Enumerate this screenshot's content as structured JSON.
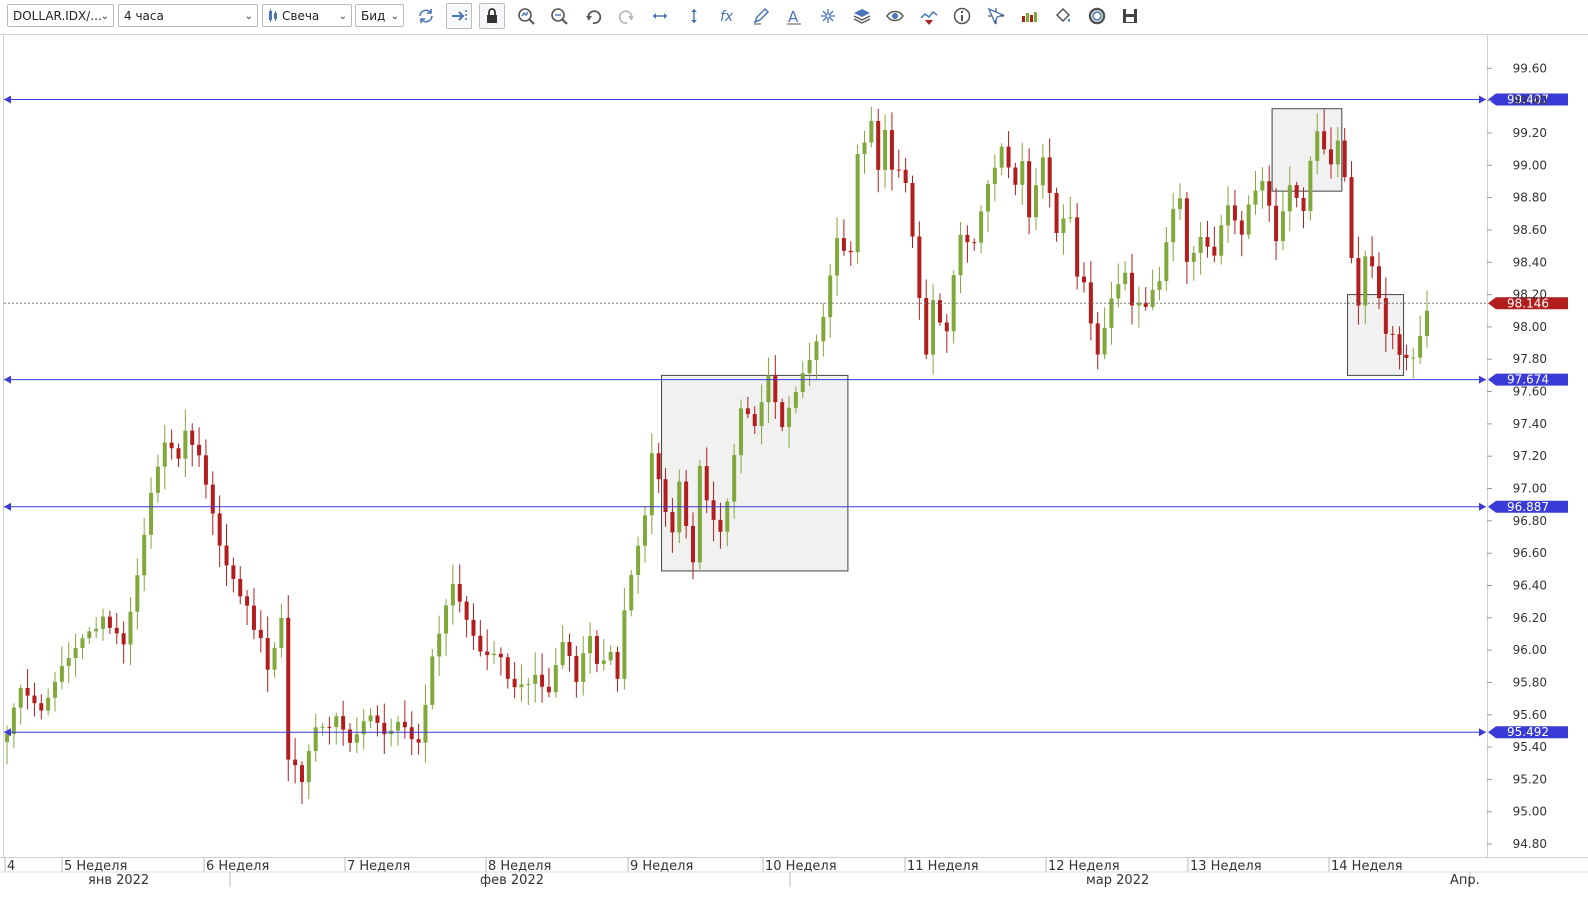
{
  "toolbar": {
    "symbol": "DOLLAR.IDX/...",
    "period": "4 часа",
    "chart_type": "Свеча",
    "price_side": "Бид",
    "tools": [
      {
        "name": "refresh-icon"
      },
      {
        "name": "autoshift-icon",
        "boxed": true
      },
      {
        "name": "lock-icon",
        "boxed": true
      },
      {
        "name": "zoom-in-icon"
      },
      {
        "name": "zoom-out-icon"
      },
      {
        "name": "undo-icon"
      },
      {
        "name": "redo-icon"
      },
      {
        "name": "horizontal-scale-icon"
      },
      {
        "name": "vertical-scale-icon"
      },
      {
        "name": "indicators-fx-icon"
      },
      {
        "name": "pencil-icon"
      },
      {
        "name": "text-tool-icon"
      },
      {
        "name": "crosshair-star-icon"
      },
      {
        "name": "layers-icon"
      },
      {
        "name": "eye-icon"
      },
      {
        "name": "signals-icon"
      },
      {
        "name": "info-icon"
      },
      {
        "name": "cursor-icon"
      },
      {
        "name": "volume-bars-icon"
      },
      {
        "name": "paint-bucket-icon"
      },
      {
        "name": "theme-icon"
      },
      {
        "name": "save-icon"
      }
    ]
  },
  "colors": {
    "up": "#80a83a",
    "down": "#b21d1d",
    "hline": "#3a3ad6",
    "current": "#b21d1d",
    "box_fill": "#efefef",
    "box_stroke": "#444444"
  },
  "chart_data": {
    "type": "candlestick",
    "title": "",
    "ylim": [
      94.72,
      99.8
    ],
    "y_ticks": [
      "99.60",
      "99.40",
      "99.20",
      "99.00",
      "98.80",
      "98.60",
      "98.40",
      "98.20",
      "98.00",
      "97.80",
      "97.60",
      "97.40",
      "97.20",
      "97.00",
      "96.80",
      "96.60",
      "96.40",
      "96.20",
      "96.00",
      "95.80",
      "95.60",
      "95.40",
      "95.20",
      "95.00",
      "94.80"
    ],
    "x_week_labels": [
      "4",
      "5 Неделя",
      "6 Неделя",
      "7 Неделя",
      "8 Неделя",
      "9 Неделя",
      "10 Неделя",
      "11 Неделя",
      "12 Неделя",
      "13 Неделя",
      "14 Неделя"
    ],
    "x_month_labels": [
      "янв 2022",
      "фев 2022",
      "мар 2022",
      "Апр."
    ],
    "horizontal_lines": [
      99.407,
      97.674,
      96.887,
      95.492
    ],
    "horizontal_line_labels": [
      "99.407",
      "97.674",
      "96.887",
      "95.492"
    ],
    "current_price": 98.146,
    "current_price_label": "98.146",
    "rectangles": [
      {
        "price_top": 97.7,
        "price_bottom": 96.49
      },
      {
        "price_top": 99.35,
        "price_bottom": 98.84
      },
      {
        "price_top": 98.2,
        "price_bottom": 97.7
      }
    ],
    "price_path": [
      [
        0,
        95.5
      ],
      [
        2,
        95.78
      ],
      [
        5,
        95.62
      ],
      [
        8,
        95.9
      ],
      [
        11,
        96.05
      ],
      [
        14,
        96.2
      ],
      [
        17,
        96.02
      ],
      [
        19,
        96.45
      ],
      [
        21,
        96.95
      ],
      [
        23,
        97.28
      ],
      [
        25,
        97.2
      ],
      [
        26,
        97.36
      ],
      [
        28,
        97.2
      ],
      [
        30,
        96.85
      ],
      [
        31,
        96.65
      ],
      [
        33,
        96.45
      ],
      [
        35,
        96.25
      ],
      [
        37,
        96.05
      ],
      [
        38,
        95.85
      ],
      [
        40,
        96.18
      ],
      [
        41,
        95.32
      ],
      [
        43,
        95.2
      ],
      [
        45,
        95.5
      ],
      [
        48,
        95.58
      ],
      [
        50,
        95.45
      ],
      [
        53,
        95.6
      ],
      [
        55,
        95.48
      ],
      [
        58,
        95.55
      ],
      [
        60,
        95.4
      ],
      [
        62,
        95.95
      ],
      [
        64,
        96.25
      ],
      [
        65,
        96.38
      ],
      [
        67,
        96.2
      ],
      [
        69,
        96.02
      ],
      [
        72,
        95.95
      ],
      [
        74,
        95.75
      ],
      [
        77,
        95.82
      ],
      [
        79,
        95.72
      ],
      [
        81,
        96.05
      ],
      [
        83,
        95.82
      ],
      [
        85,
        96.1
      ],
      [
        86,
        95.9
      ],
      [
        88,
        96.0
      ],
      [
        89,
        95.85
      ],
      [
        90,
        96.25
      ],
      [
        92,
        96.62
      ],
      [
        93,
        96.85
      ],
      [
        94,
        97.2
      ],
      [
        95,
        97.05
      ],
      [
        96,
        96.85
      ],
      [
        97,
        96.7
      ],
      [
        98,
        97.05
      ],
      [
        99,
        96.75
      ],
      [
        100,
        96.55
      ],
      [
        101,
        97.15
      ],
      [
        102,
        96.95
      ],
      [
        103,
        96.78
      ],
      [
        104,
        96.72
      ],
      [
        105,
        96.9
      ],
      [
        107,
        97.5
      ],
      [
        109,
        97.4
      ],
      [
        111,
        97.7
      ],
      [
        113,
        97.4
      ],
      [
        115,
        97.6
      ],
      [
        117,
        97.78
      ],
      [
        119,
        98.05
      ],
      [
        121,
        98.55
      ],
      [
        123,
        98.45
      ],
      [
        124,
        99.05
      ],
      [
        126,
        99.25
      ],
      [
        127,
        98.95
      ],
      [
        128,
        99.2
      ],
      [
        129,
        99.0
      ],
      [
        131,
        98.9
      ],
      [
        132,
        98.55
      ],
      [
        133,
        98.15
      ],
      [
        134,
        97.85
      ],
      [
        135,
        98.15
      ],
      [
        136,
        98.05
      ],
      [
        137,
        97.95
      ],
      [
        138,
        98.35
      ],
      [
        139,
        98.55
      ],
      [
        141,
        98.5
      ],
      [
        143,
        98.9
      ],
      [
        145,
        99.1
      ],
      [
        147,
        98.85
      ],
      [
        148,
        99.05
      ],
      [
        149,
        98.7
      ],
      [
        151,
        99.05
      ],
      [
        152,
        98.85
      ],
      [
        153,
        98.6
      ],
      [
        155,
        98.7
      ],
      [
        156,
        98.3
      ],
      [
        157,
        98.25
      ],
      [
        158,
        98.05
      ],
      [
        159,
        97.8
      ],
      [
        160,
        98.0
      ],
      [
        161,
        98.2
      ],
      [
        163,
        98.35
      ],
      [
        164,
        98.15
      ],
      [
        166,
        98.1
      ],
      [
        168,
        98.3
      ],
      [
        170,
        98.7
      ],
      [
        171,
        98.8
      ],
      [
        172,
        98.4
      ],
      [
        174,
        98.55
      ],
      [
        176,
        98.45
      ],
      [
        178,
        98.75
      ],
      [
        180,
        98.6
      ],
      [
        181,
        98.75
      ],
      [
        183,
        98.9
      ],
      [
        185,
        98.55
      ],
      [
        187,
        98.85
      ],
      [
        189,
        98.7
      ],
      [
        190,
        99.05
      ],
      [
        191,
        99.2
      ],
      [
        193,
        99.0
      ],
      [
        194,
        99.15
      ],
      [
        195,
        98.95
      ],
      [
        196,
        98.4
      ],
      [
        197,
        98.15
      ],
      [
        198,
        98.45
      ],
      [
        199,
        98.35
      ],
      [
        201,
        97.95
      ],
      [
        202,
        97.95
      ],
      [
        203,
        97.8
      ],
      [
        205,
        97.82
      ],
      [
        207,
        98.1
      ]
    ],
    "n_candles": 208
  }
}
